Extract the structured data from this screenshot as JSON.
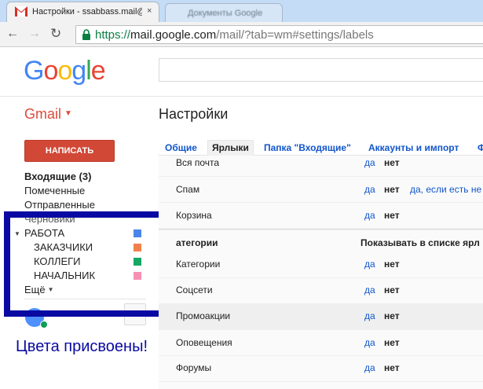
{
  "browser": {
    "tabs": [
      {
        "title": "Настройки - ssabbass.mail@",
        "close": "×"
      },
      {
        "title": "Документы Google"
      }
    ],
    "url": {
      "scheme": "https://",
      "host": "mail.google.com",
      "path": "/mail/?tab=wm#settings/labels"
    }
  },
  "header": {
    "logo_letters": [
      "G",
      "o",
      "o",
      "g",
      "l",
      "e"
    ],
    "gmail_menu_label": "Gmail",
    "page_title": "Настройки"
  },
  "sidebar": {
    "compose_label": "НАПИСАТЬ",
    "inbox_label": "Входящие (3)",
    "starred_label": "Помеченные",
    "sent_label": "Отправленные",
    "drafts_label": "Черновики",
    "labels": [
      {
        "name": "РАБОТА",
        "color": "#4a86e8"
      },
      {
        "name": "ЗАКАЗЧИКИ",
        "color": "#f2804c"
      },
      {
        "name": "КОЛЛЕГИ",
        "color": "#16a765"
      },
      {
        "name": "НАЧАЛЬНИК",
        "color": "#f691b2"
      }
    ],
    "more_label": "Ещё"
  },
  "annotation": {
    "caption": "Цвета присвоены!",
    "color": "#0a0aa3"
  },
  "settings": {
    "tabs": [
      "Общие",
      "Ярлыки",
      "Папка \"Входящие\"",
      "Аккаунты и импорт",
      "Ф"
    ],
    "active_tab": "Ярлыки",
    "system_rows": [
      {
        "name": "Вся почта",
        "yes": "да",
        "no": "нет"
      },
      {
        "name": "Спам",
        "yes": "да",
        "no": "нет",
        "extra": "да, если есть не"
      },
      {
        "name": "Корзина",
        "yes": "да",
        "no": "нет"
      }
    ],
    "section": {
      "title": "атегории",
      "show_header": "Показывать в списке ярл"
    },
    "category_rows": [
      {
        "name": "Категории",
        "yes": "да",
        "no": "нет"
      },
      {
        "name": "Соцсети",
        "yes": "да",
        "no": "нет"
      },
      {
        "name": "Промоакции",
        "yes": "да",
        "no": "нет"
      },
      {
        "name": "Оповещения",
        "yes": "да",
        "no": "нет"
      },
      {
        "name": "Форумы",
        "yes": "да",
        "no": "нет"
      }
    ]
  }
}
